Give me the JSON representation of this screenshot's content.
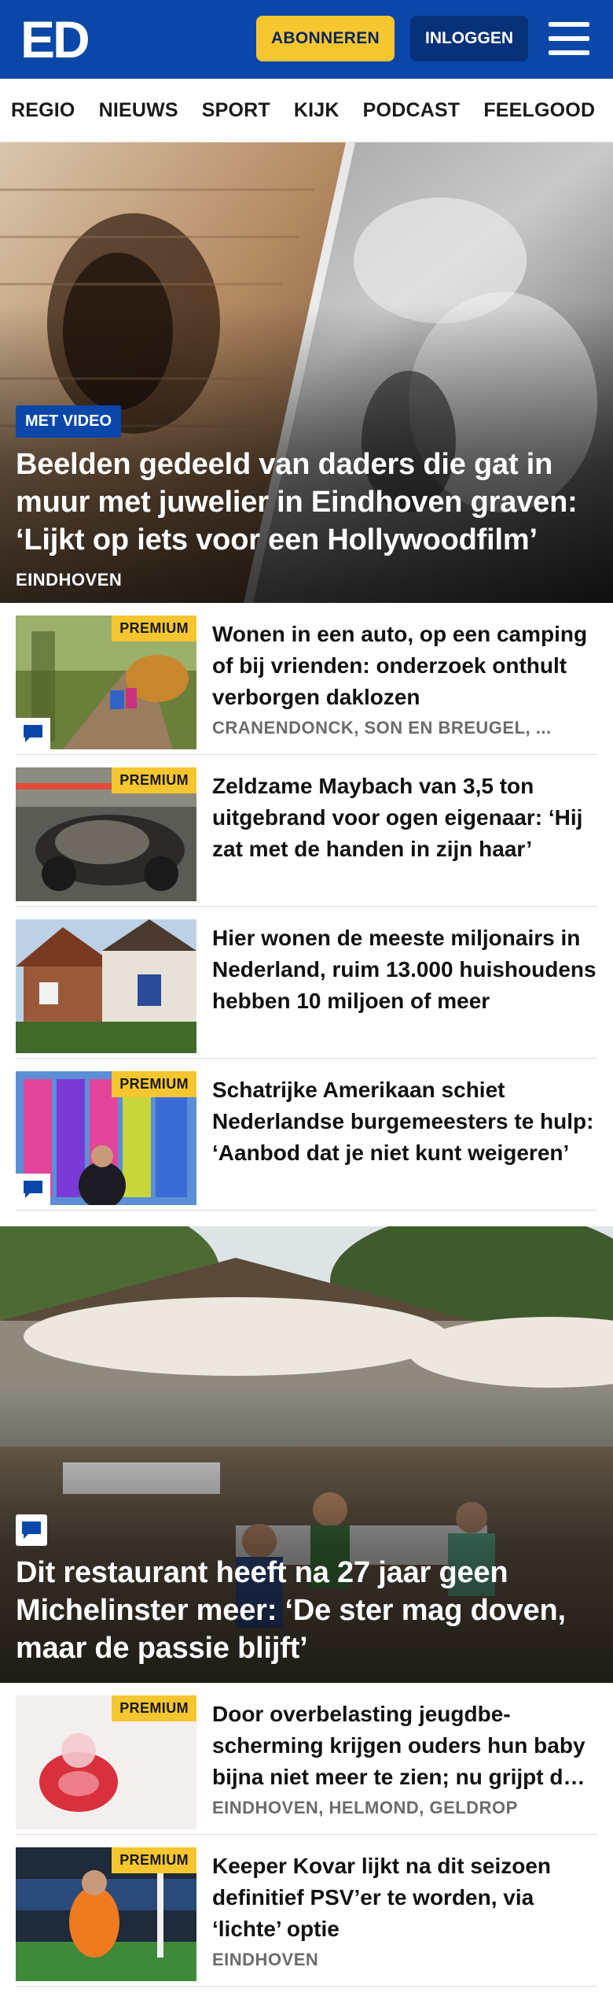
{
  "header": {
    "logo": "ED",
    "subscribe_label": "ABONNEREN",
    "login_label": "INLOGGEN"
  },
  "nav": {
    "items": [
      "REGIO",
      "NIEUWS",
      "SPORT",
      "KIJK",
      "PODCAST",
      "FEELGOOD"
    ]
  },
  "hero1": {
    "badge": "MET VIDEO",
    "title": "Beelden gedeeld van daders die gat in muur met juwelier in Eindhoven graven: ‘Lijkt op iets voor een Hollywoodfilm’",
    "tag": "EINDHOVEN"
  },
  "list1": [
    {
      "premium": "PREMIUM",
      "title": "Wonen in een auto, op een camping of bij vrienden: onderzoek onthult verborgen daklozen",
      "tag": "CRANENDONCK, SON EN BREUGEL, ..."
    },
    {
      "premium": "PREMIUM",
      "title": "Zeldzame Maybach van 3,5 ton uitgebrand voor ogen eigenaar: ‘Hij zat met de handen in zijn haar’",
      "tag": ""
    },
    {
      "premium": "",
      "title": "Hier wonen de meeste miljonairs in Nederland, ruim 13.000 huishoudens hebben 10 miljoen of meer",
      "tag": ""
    },
    {
      "premium": "PREMIUM",
      "title": "Schatrijke Amerikaan schiet Nederlandse burgemeesters te hulp: ‘Aanbod dat je niet kunt weigeren’",
      "tag": ""
    }
  ],
  "hero2": {
    "title": "Dit restaurant heeft na 27 jaar geen Michelinster meer: ‘De ster mag doven, maar de passie blijft’"
  },
  "list2": [
    {
      "premium": "PREMIUM",
      "title": "Door overbelasting jeugdbe­scherming krijgen ouders hun baby bijna niet meer te zien; nu grijpt de rechter in",
      "tag": "EINDHOVEN, HELMOND, GELDROP"
    },
    {
      "premium": "PREMIUM",
      "title": "Keeper Kovar lijkt na dit seizoen definitief PSV’er te worden, via ‘lichte’ optie",
      "tag": "EINDHOVEN"
    }
  ],
  "colors": {
    "brand_blue": "#0a47a9",
    "premium_yellow": "#f5c62f"
  },
  "icons": [
    "menu-icon",
    "comment-icon"
  ]
}
